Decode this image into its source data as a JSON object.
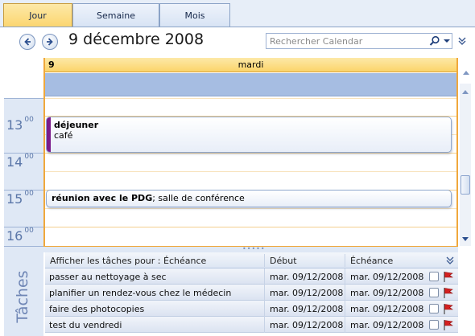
{
  "tabs": {
    "day": "Jour",
    "week": "Semaine",
    "month": "Mois"
  },
  "header": {
    "date_title": "9 décembre 2008",
    "search_placeholder": "Rechercher Calendar"
  },
  "day": {
    "number": "9",
    "name": "mardi"
  },
  "hours": [
    {
      "h": "13",
      "m": "00"
    },
    {
      "h": "14",
      "m": "00"
    },
    {
      "h": "15",
      "m": "00"
    },
    {
      "h": "16",
      "m": "00"
    }
  ],
  "appointments": [
    {
      "title": "déjeuner",
      "location": "café"
    },
    {
      "title": "réunion avec le PDG",
      "location": "; salle de conférence"
    }
  ],
  "tasks": {
    "label": "Tâches",
    "header": {
      "subject": "Afficher les tâches pour : Échéance",
      "start": "Début",
      "due": "Échéance"
    },
    "rows": [
      {
        "subject": "passer au nettoyage à sec",
        "start": "mar. 09/12/2008",
        "due": "mar. 09/12/2008"
      },
      {
        "subject": "planifier un rendez-vous chez le médecin",
        "start": "mar. 09/12/2008",
        "due": "mar. 09/12/2008"
      },
      {
        "subject": "faire des photocopies",
        "start": "mar. 09/12/2008",
        "due": "mar. 09/12/2008"
      },
      {
        "subject": "test du vendredi",
        "start": "mar. 09/12/2008",
        "due": "mar. 09/12/2008"
      }
    ]
  },
  "colors": {
    "accent_orange": "#f0a83c",
    "busy_bar_purple": "#7a1a8a",
    "flag_red": "#d42020"
  },
  "icons": [
    "back-arrow-icon",
    "forward-arrow-icon",
    "search-icon",
    "dropdown-icon",
    "expand-chevron-icon",
    "flag-icon"
  ]
}
